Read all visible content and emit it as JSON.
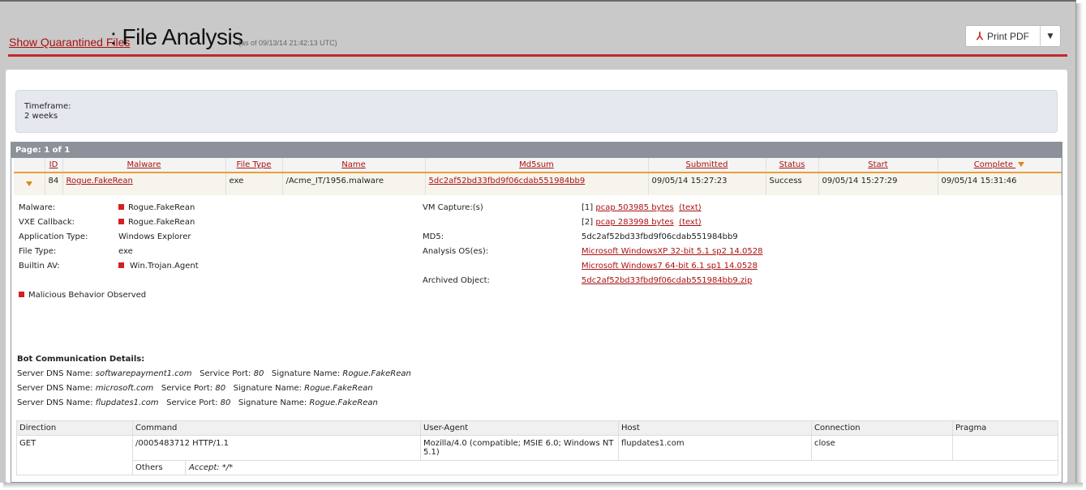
{
  "header": {
    "link_label": "Show Quarantined Files",
    "title": ": File Analysis",
    "as_of": "(as of 09/13/14 21:42:13 UTC)",
    "print_pdf_label": "Print PDF",
    "accent_color": "#c32a2a"
  },
  "timeframe": {
    "label": "Timeframe:",
    "value": "2 weeks"
  },
  "grid": {
    "page_label": "Page: 1 of 1",
    "columns": [
      "ID",
      "Malware",
      "File Type",
      "Name",
      "Md5sum",
      "Submitted",
      "Status",
      "Start",
      "Complete"
    ],
    "row": {
      "id": "84",
      "malware": "Rogue.FakeRean",
      "file_type": "exe",
      "name": "/Acme_IT/1956.malware",
      "md5": "5dc2af52bd33fbd9f06cdab551984bb9",
      "submitted": "09/05/14 15:27:23",
      "status": "Success",
      "start": "09/05/14 15:27:29",
      "complete": "09/05/14 15:31:46"
    }
  },
  "details": {
    "malware_label": "Malware:",
    "malware_value": "Rogue.FakeRean",
    "vxe_label": "VXE Callback:",
    "vxe_value": "Rogue.FakeRean",
    "app_type_label": "Application Type:",
    "app_type_value": "Windows Explorer",
    "file_type_label": "File Type:",
    "file_type_value": "exe",
    "builtin_av_label": "Builtin AV:",
    "builtin_av_value": "Win.Trojan.Agent",
    "malicious_label": "Malicious Behavior Observed",
    "vm_capture_label": "VM Capture:(s)",
    "cap1_idx": "[1]",
    "cap1_link": "pcap 503985 bytes",
    "cap1_text": "(text)",
    "cap2_idx": "[2]",
    "cap2_link": "pcap 283998 bytes",
    "cap2_text": "(text)",
    "md5_label": "MD5:",
    "md5_value": "5dc2af52bd33fbd9f06cdab551984bb9",
    "analysis_os_label": "Analysis OS(es):",
    "os1": "Microsoft WindowsXP 32-bit 5.1 sp2 14.0528",
    "os2": "Microsoft Windows7 64-bit 6.1 sp1 14.0528",
    "archived_label": "Archived Object:",
    "archived_value": "5dc2af52bd33fbd9f06cdab551984bb9.zip"
  },
  "bot": {
    "heading": "Bot Communication Details:",
    "dns_label": "Server DNS Name:",
    "port_label": "Service Port:",
    "sig_label": "Signature Name:",
    "entries": [
      {
        "dns": "softwarepayment1.com",
        "port": "80",
        "sig": "Rogue.FakeRean"
      },
      {
        "dns": "microsoft.com",
        "port": "80",
        "sig": "Rogue.FakeRean"
      },
      {
        "dns": "flupdates1.com",
        "port": "80",
        "sig": "Rogue.FakeRean"
      }
    ]
  },
  "comm_table": {
    "columns": [
      "Direction",
      "Command",
      "User-Agent",
      "Host",
      "Connection",
      "Pragma"
    ],
    "row": {
      "direction": "GET",
      "command": "/0005483712 HTTP/1.1",
      "user_agent": "Mozilla/4.0 (compatible; MSIE 6.0; Windows NT 5.1)",
      "host": "flupdates1.com",
      "connection": "close",
      "pragma": ""
    },
    "others_label": "Others",
    "others_value": "Accept: */*"
  }
}
